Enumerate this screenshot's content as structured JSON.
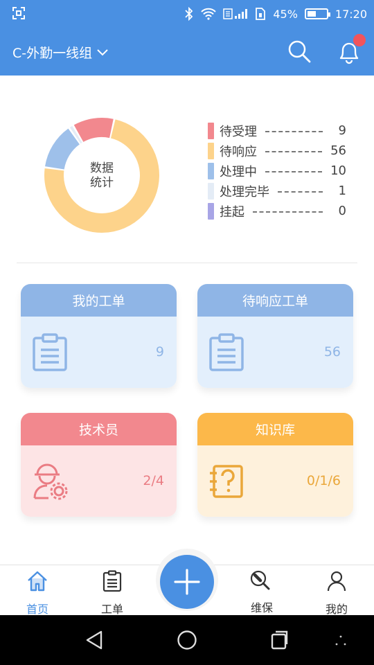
{
  "status_bar": {
    "battery": "45%",
    "time": "17:20",
    "battery_level": 0.45
  },
  "header": {
    "team_name": "C-外勤一线组",
    "has_notification": true
  },
  "donut": {
    "center_line1": "数据",
    "center_line2": "统计",
    "segments": [
      {
        "label": "待受理",
        "value": 9,
        "color": "#f2888e"
      },
      {
        "label": "待响应",
        "value": 56,
        "color": "#fdd38b"
      },
      {
        "label": "处理中",
        "value": 10,
        "color": "#9ec0ea"
      },
      {
        "label": "处理完毕",
        "value": 1,
        "color": "#e4ecf6"
      },
      {
        "label": "挂起",
        "value": 0,
        "color": "#a8a5e6"
      }
    ]
  },
  "legend": [
    {
      "label": "待受理",
      "value": "9",
      "color": "#f2888e"
    },
    {
      "label": "待响应",
      "value": "56",
      "color": "#fdd38b"
    },
    {
      "label": "处理中",
      "value": "10",
      "color": "#9ec0ea"
    },
    {
      "label": "处理完毕",
      "value": "1",
      "color": "#e4ecf6"
    },
    {
      "label": "挂起",
      "value": "0",
      "color": "#a8a5e6"
    }
  ],
  "cards": {
    "my_orders": {
      "title": "我的工单",
      "value": "9",
      "icon": "clipboard-icon"
    },
    "pending_response": {
      "title": "待响应工单",
      "value": "56",
      "icon": "clipboard-icon"
    },
    "technicians": {
      "title": "技术员",
      "value": "2/4",
      "icon": "technician-icon"
    },
    "knowledge_base": {
      "title": "知识库",
      "value": "0/1/6",
      "icon": "question-book-icon"
    }
  },
  "colors": {
    "primary": "#4a90e2",
    "blue_card_head": "#8fb5e6",
    "blue_card_body": "#e3effc",
    "blue_card_text": "#8fb5e6",
    "red_card_head": "#f2888e",
    "red_card_body": "#fde4e5",
    "red_card_text": "#ea7c83",
    "orange_card_head": "#fcb84a",
    "orange_card_body": "#fef1dc",
    "orange_card_text": "#eaa73a"
  },
  "tabs": [
    {
      "label": "首页",
      "icon": "home-icon",
      "active": true
    },
    {
      "label": "工单",
      "icon": "clipboard-icon",
      "active": false
    },
    {
      "label": "维保",
      "icon": "wrench-icon",
      "active": false
    },
    {
      "label": "我的",
      "icon": "user-icon",
      "active": false
    }
  ]
}
